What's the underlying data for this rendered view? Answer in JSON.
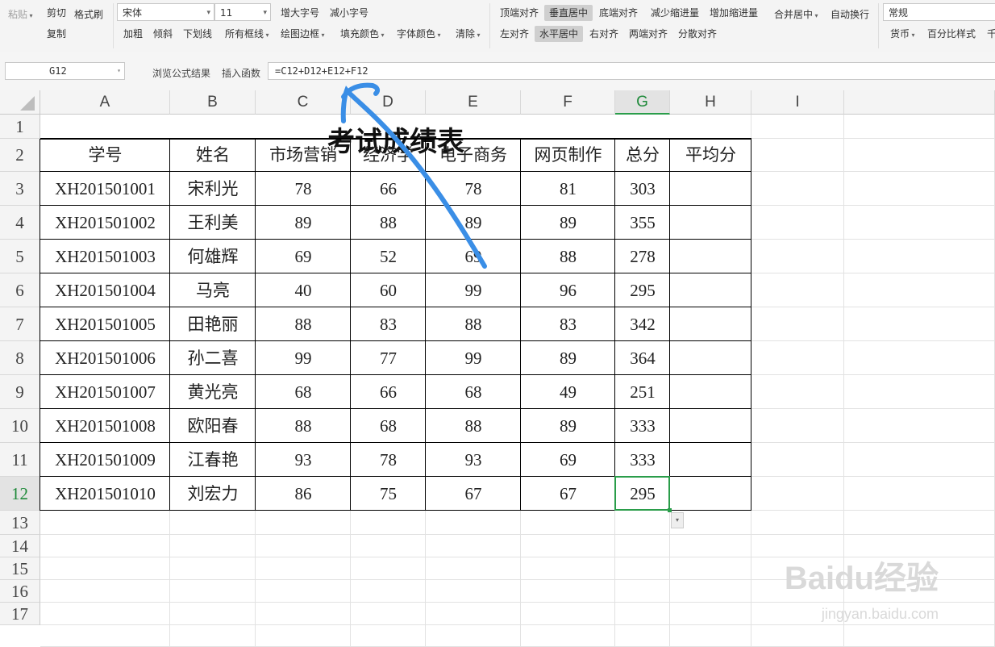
{
  "ribbon": {
    "paste": "粘贴",
    "cut": "剪切",
    "format_painter": "格式刷",
    "copy": "复制",
    "font_name": "宋体",
    "font_size": "11",
    "increase_font": "增大字号",
    "decrease_font": "减小字号",
    "bold": "加粗",
    "italic": "倾斜",
    "underline": "下划线",
    "all_borders": "所有框线",
    "draw_border": "绘图边框",
    "fill_color": "填充颜色",
    "font_color": "字体颜色",
    "clear": "清除",
    "align_top": "顶端对齐",
    "align_middle": "垂直居中",
    "align_bottom": "底端对齐",
    "decrease_indent": "减少缩进量",
    "increase_indent": "增加缩进量",
    "merge_center": "合并居中",
    "wrap_text": "自动换行",
    "align_left": "左对齐",
    "align_center": "水平居中",
    "align_right": "右对齐",
    "justify": "两端对齐",
    "distributed": "分散对齐",
    "number_format": "常规",
    "currency": "货币",
    "percent": "百分比样式",
    "thousands": "千"
  },
  "formula_bar": {
    "name_box": "G12",
    "browse_formula": "浏览公式结果",
    "insert_function": "插入函数",
    "formula": "=C12+D12+E12+F12"
  },
  "columns": [
    "A",
    "B",
    "C",
    "D",
    "E",
    "F",
    "G",
    "H",
    "I"
  ],
  "rows": [
    "1",
    "2",
    "3",
    "4",
    "5",
    "6",
    "7",
    "8",
    "9",
    "10",
    "11",
    "12",
    "13",
    "14",
    "15",
    "16",
    "17"
  ],
  "sheet": {
    "title": "考试成绩表",
    "headers": [
      "学号",
      "姓名",
      "市场营销",
      "经济学",
      "电子商务",
      "网页制作",
      "总分",
      "平均分"
    ],
    "records": [
      [
        "XH201501001",
        "宋利光",
        "78",
        "66",
        "78",
        "81",
        "303",
        ""
      ],
      [
        "XH201501002",
        "王利美",
        "89",
        "88",
        "89",
        "89",
        "355",
        ""
      ],
      [
        "XH201501003",
        "何雄辉",
        "69",
        "52",
        "69",
        "88",
        "278",
        ""
      ],
      [
        "XH201501004",
        "马亮",
        "40",
        "60",
        "99",
        "96",
        "295",
        ""
      ],
      [
        "XH201501005",
        "田艳丽",
        "88",
        "83",
        "88",
        "83",
        "342",
        ""
      ],
      [
        "XH201501006",
        "孙二喜",
        "99",
        "77",
        "99",
        "89",
        "364",
        ""
      ],
      [
        "XH201501007",
        "黄光亮",
        "68",
        "66",
        "68",
        "49",
        "251",
        ""
      ],
      [
        "XH201501008",
        "欧阳春",
        "88",
        "68",
        "88",
        "89",
        "333",
        ""
      ],
      [
        "XH201501009",
        "江春艳",
        "93",
        "78",
        "93",
        "69",
        "333",
        ""
      ],
      [
        "XH201501010",
        "刘宏力",
        "86",
        "75",
        "67",
        "67",
        "295",
        ""
      ]
    ]
  },
  "selected_cell": {
    "column": "G",
    "row": "12"
  },
  "watermark": {
    "brand": "Baidu经验",
    "url": "jingyan.baidu.com"
  },
  "colors": {
    "selection": "#2a9d4a",
    "annotation_arrow": "#3a8ee6"
  }
}
